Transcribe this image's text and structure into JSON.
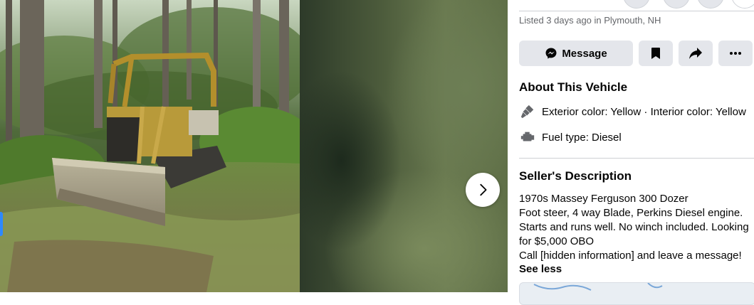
{
  "listing": {
    "listed_text": "Listed 3 days ago in Plymouth, NH"
  },
  "actions": {
    "message_label": "Message",
    "message_icon": "messenger-icon",
    "save_icon": "bookmark-icon",
    "share_icon": "share-arrow-icon",
    "more_icon": "more-dots-icon"
  },
  "about": {
    "title": "About This Vehicle",
    "color_text": "Exterior color: Yellow · Interior color: Yellow",
    "color_icon": "paint-brush-icon",
    "fuel_text": "Fuel type: Diesel",
    "fuel_icon": "engine-icon"
  },
  "description": {
    "title": "Seller's Description",
    "lines": [
      "1970s Massey Ferguson 300 Dozer",
      "Foot steer, 4 way Blade, Perkins Diesel engine.",
      "Starts and runs well. No winch included. Looking",
      "for $5,000 OBO",
      "Call [hidden information] and leave a message!"
    ],
    "see_less": "See less"
  },
  "viewer": {
    "next_icon": "chevron-right-icon",
    "photo_subject": "yellow bulldozer in forest clearing"
  },
  "colors": {
    "button_bg": "#e4e6eb",
    "secondary_text": "#65676b",
    "divider": "#ced0d4"
  }
}
